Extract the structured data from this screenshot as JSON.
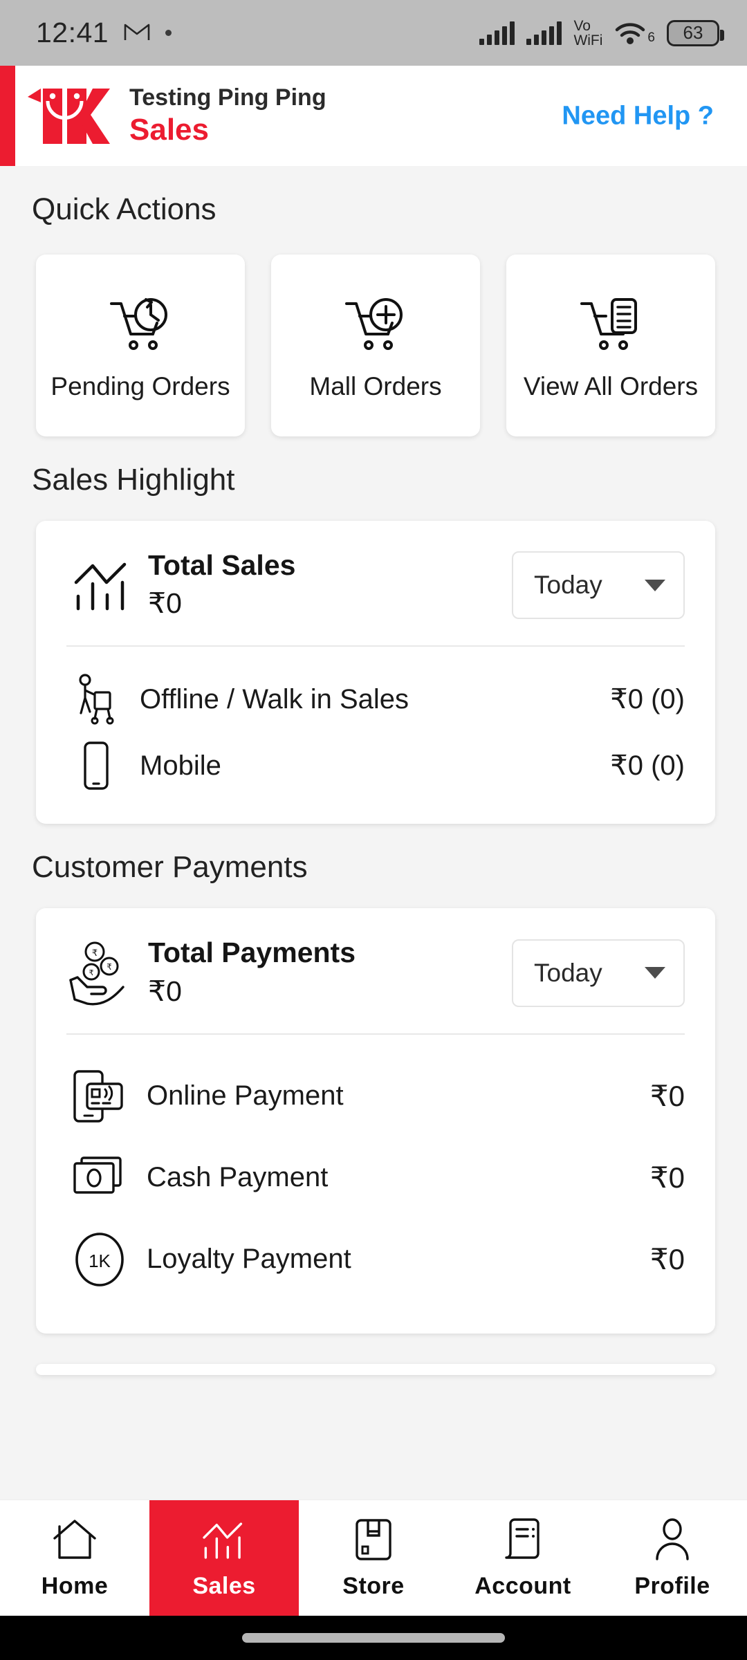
{
  "statusbar": {
    "time": "12:41",
    "gmail_icon": "gmail-icon",
    "dot_icon": "notification-dot-icon",
    "signal1_icon": "signal-bars-icon",
    "signal2_icon": "signal-bars-icon",
    "volte_line1": "Vo",
    "volte_line2": "WiFi",
    "wifi_icon": "wifi-icon",
    "wifi_generation": "6",
    "battery_level": "63"
  },
  "header": {
    "logo": "1k-logo",
    "store_name": "Testing Ping Ping",
    "page_title": "Sales",
    "need_help": "Need Help ?"
  },
  "quick_actions": {
    "title": "Quick Actions",
    "items": [
      {
        "label": "Pending Orders",
        "icon": "cart-clock-icon"
      },
      {
        "label": "Mall Orders",
        "icon": "cart-plus-icon"
      },
      {
        "label": "View All Orders",
        "icon": "cart-list-icon"
      }
    ]
  },
  "sales_highlight": {
    "title": "Sales Highlight",
    "card": {
      "icon": "bar-chart-line-icon",
      "title": "Total Sales",
      "value": "₹0",
      "period": "Today",
      "caret_icon": "chevron-down-icon"
    },
    "rows": [
      {
        "icon": "walk-in-shopper-icon",
        "label": "Offline / Walk in Sales",
        "value": "₹0 (0)"
      },
      {
        "icon": "mobile-phone-icon",
        "label": "Mobile",
        "value": "₹0 (0)"
      }
    ]
  },
  "customer_payments": {
    "title": "Customer Payments",
    "card": {
      "icon": "hand-coins-icon",
      "title": "Total Payments",
      "value": "₹0",
      "period": "Today",
      "caret_icon": "chevron-down-icon"
    },
    "rows": [
      {
        "icon": "online-payment-icon",
        "label": "Online Payment",
        "value": "₹0"
      },
      {
        "icon": "cash-note-icon",
        "label": "Cash Payment",
        "value": "₹0"
      },
      {
        "icon": "loyalty-1k-icon",
        "label": "Loyalty Payment",
        "value": "₹0"
      }
    ]
  },
  "bottom_nav": {
    "items": [
      {
        "label": "Home",
        "icon": "home-icon",
        "active": false
      },
      {
        "label": "Sales",
        "icon": "bar-chart-line-icon",
        "active": true
      },
      {
        "label": "Store",
        "icon": "store-icon",
        "active": false
      },
      {
        "label": "Account",
        "icon": "receipt-icon",
        "active": false
      },
      {
        "label": "Profile",
        "icon": "person-icon",
        "active": false
      }
    ]
  },
  "colors": {
    "brand_red": "#ec1c30",
    "link_blue": "#2196f3",
    "page_background": "#f4f4f4",
    "card_background": "#ffffff",
    "statusbar_background": "#bdbdbd"
  }
}
